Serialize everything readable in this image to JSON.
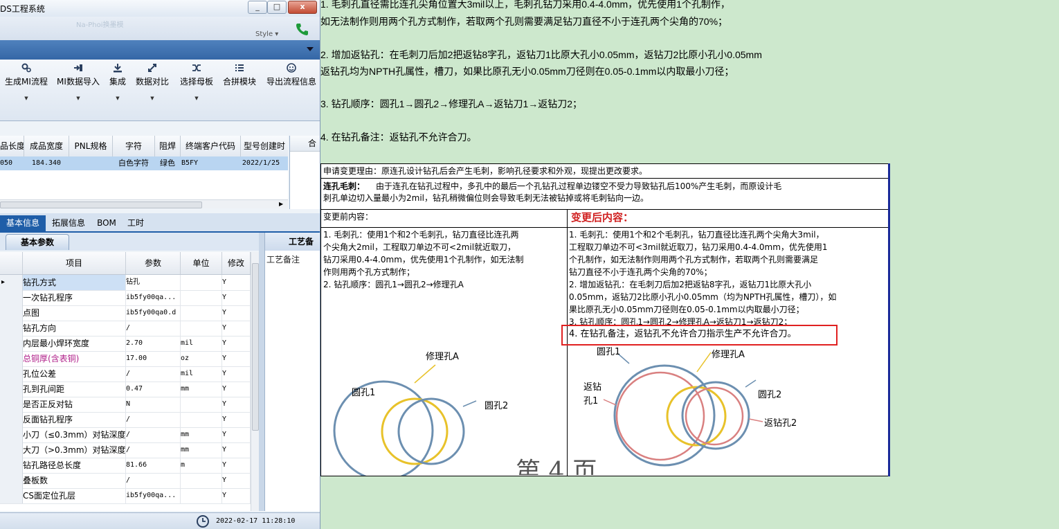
{
  "window": {
    "title": "DS工程系统",
    "ribbon_caption": "Na-Phoi换墨模",
    "style_label": "Style ▾",
    "minimize": "_",
    "maximize": "□",
    "close": "x"
  },
  "toolbar": [
    {
      "label": "生成MI流程",
      "icon": "gears-icon",
      "dropdown": true
    },
    {
      "label": "MI数据导入",
      "icon": "import-icon",
      "dropdown": true
    },
    {
      "label": "集成",
      "icon": "download-icon",
      "dropdown": true
    },
    {
      "label": "数据对比",
      "icon": "compare-icon",
      "dropdown": true
    },
    {
      "label": "选择母板",
      "icon": "shuffle-icon",
      "dropdown": true
    },
    {
      "label": "合拼模块",
      "icon": "list-icon",
      "dropdown": false
    },
    {
      "label": "导出流程信息",
      "icon": "smile-icon",
      "dropdown": false
    }
  ],
  "product_grid": {
    "headers": [
      "品长度",
      "成品宽度",
      "PNL规格",
      "字符",
      "阻焊",
      "终端客户代码",
      "型号创建时",
      "合"
    ],
    "row": [
      "050",
      "184.340",
      "",
      "白色字符",
      "绿色",
      "B5FY",
      "2022/1/25"
    ]
  },
  "tabs": [
    "基本信息",
    "拓展信息",
    "BOM",
    "工时"
  ],
  "subtab": "基本参数",
  "side_panel": {
    "title": "工艺备",
    "label": "工艺备注"
  },
  "params": {
    "headers": [
      "项目",
      "参数",
      "单位",
      "修改"
    ],
    "rows": [
      {
        "item": "钻孔方式",
        "value": "钻孔",
        "unit": "",
        "flag": "Y"
      },
      {
        "item": "一次钻孔程序",
        "value": "ib5fy00qa...",
        "unit": "",
        "flag": "Y"
      },
      {
        "item": "点图",
        "value": "ib5fy00qa0.d",
        "unit": "",
        "flag": "Y"
      },
      {
        "item": "钻孔方向",
        "value": "/",
        "unit": "",
        "flag": "Y"
      },
      {
        "item": "内层最小焊环宽度",
        "value": "2.70",
        "unit": "mil",
        "flag": "Y"
      },
      {
        "item": "总铜厚(含表铜)",
        "value": "17.00",
        "unit": "oz",
        "flag": "Y"
      },
      {
        "item": "孔位公差",
        "value": "/",
        "unit": "mil",
        "flag": "Y"
      },
      {
        "item": "孔到孔间距",
        "value": "0.47",
        "unit": "mm",
        "flag": "Y"
      },
      {
        "item": "是否正反对钻",
        "value": "N",
        "unit": "",
        "flag": "Y"
      },
      {
        "item": "反面钻孔程序",
        "value": "/",
        "unit": "",
        "flag": "Y"
      },
      {
        "item": "小刀（≤0.3mm）对钻深度",
        "value": "/",
        "unit": "mm",
        "flag": "Y"
      },
      {
        "item": "大刀（>0.3mm）对钻深度",
        "value": "/",
        "unit": "mm",
        "flag": "Y"
      },
      {
        "item": "钻孔路径总长度",
        "value": "81.66",
        "unit": "m",
        "flag": "Y"
      },
      {
        "item": "叠板数",
        "value": "/",
        "unit": "",
        "flag": "Y"
      },
      {
        "item": "CS面定位孔层",
        "value": "ib5fy00qa...",
        "unit": "",
        "flag": "Y"
      }
    ]
  },
  "status": {
    "time": "2022-02-17 11:28:10"
  },
  "document": {
    "lines": [
      "1. 毛刺孔直径需比连孔尖角位置大3mil以上，毛刺孔钻刀采用0.4-4.0mm，优先使用1个孔制作，",
      "如无法制作则用两个孔方式制作，若取两个孔则需要满足钻刀直径不小于连孔两个尖角的70%；",
      "2. 增加返钻孔：在毛刺刀后加2把返钻8字孔，返钻刀1比原大孔小0.05mm，返钻刀2比原小孔小0.05mm",
      "返钻孔均为NPTH孔属性，槽刀，如果比原孔无小0.05mm刀径则在0.05-0.1mm以内取最小刀径；",
      "3. 钻孔顺序：圆孔1→圆孔2→修理孔A→返钻刀1→返钻刀2；",
      "4. 在钻孔备注：返钻孔不允许合刀。"
    ],
    "table": {
      "reason": "申请变更理由：原连孔设计钻孔后会产生毛刺，影响孔径要求和外观，现提出更改要求。",
      "burr_label": "连孔毛刺：",
      "burr_text_1": "由于连孔在钻孔过程中，多孔中的最后一个孔钻孔过程单边镂空不受力导致钻孔后100%产生毛刺，而原设计毛",
      "burr_text_2": "刺孔单边切入量最小为2mil，钻孔稍微偏位则会导致毛刺无法被钻掉或将毛刺钻向一边。",
      "before_title": "变更前内容：",
      "after_title": "变更后内容：",
      "before_lines": [
        "1. 毛刺孔：使用1个和2个毛刺孔，钻刀直径比连孔两",
        "个尖角大2mil，工程取刀单边不可<2mil就近取刀，",
        "钻刀采用0.4-4.0mm，优先使用1个孔制作，如无法制",
        "作则用两个孔方式制作；",
        "2. 钻孔顺序：圆孔1→圆孔2→修理孔A"
      ],
      "after_lines": [
        "1. 毛刺孔：使用1个和2个毛刺孔，钻刀直径比连孔两个尖角大3mil，",
        "工程取刀单边不可<3mil就近取刀，钻刀采用0.4-4.0mm，优先使用1",
        "个孔制作，如无法制作则用两个孔方式制作，若取两个孔则需要满足",
        "钻刀直径不小于连孔两个尖角的70%；",
        "2. 增加返钻孔：在毛刺刀后加2把返钻8字孔，返钻刀1比原大孔小",
        "0.05mm，返钻刀2比原小孔小0.05mm（均为NPTH孔属性，槽刀），如",
        "果比原孔无小0.05mm刀径则在0.05-0.1mm以内取最小刀径；",
        "3. 钻孔顺序：圆孔1→圆孔2→修理孔A→返钻刀1→返钻刀2；",
        "4. 在钻孔备注，返钻孔不允许合刀指示生产不允许合刀。"
      ],
      "before_diagram": {
        "hole1": "圆孔1",
        "hole2": "圆孔2",
        "repair": "修理孔A"
      },
      "after_diagram": {
        "hole1": "圆孔1",
        "hole2": "圆孔2",
        "repair": "修理孔A",
        "back1_a": "返钻",
        "back1_b": "孔1",
        "back2": "返钻孔2"
      },
      "watermark": "第 4 页"
    }
  },
  "colors": {
    "accent": "#1f5ea8",
    "after_title": "#d02020",
    "highlight": "#e02020",
    "ring_blue": "#6c8fb0",
    "ring_yellow": "#e8c22a",
    "ring_red": "#d98080",
    "page_bg": "#cde8cd"
  }
}
